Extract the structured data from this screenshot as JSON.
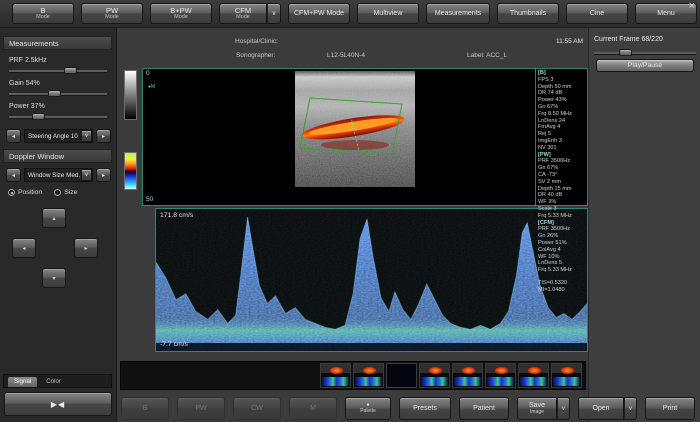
{
  "icons": {
    "close": "×",
    "dropdown": "∨",
    "arrow_left": "◂",
    "arrow_right": "▸",
    "arrow_up": "▴",
    "arrow_down": "▾",
    "collapse": "▶◀",
    "palette_dot": "●"
  },
  "toolbar": {
    "buttons": [
      {
        "label": "B",
        "sub": "Mode"
      },
      {
        "label": "PW",
        "sub": "Mode"
      },
      {
        "label": "B+PW",
        "sub": "Mode"
      },
      {
        "label": "CFM",
        "sub": "Mode"
      },
      {
        "label": "CFM+PW Mode"
      },
      {
        "label": "Multiview"
      },
      {
        "label": "Measurements"
      },
      {
        "label": "Thumbnails"
      },
      {
        "label": "Cine"
      },
      {
        "label": "Menu"
      }
    ]
  },
  "left_panel": {
    "measurements_header": "Measurements",
    "prf_label": "PRF 2.5kHz",
    "gain_label": "Gain 54%",
    "power_label": "Power 37%",
    "steering_label": "Steering Angle 10",
    "doppler_header": "Doppler Window",
    "window_size_label": "Window Size Med.",
    "radio_position": "Position",
    "radio_size": "Size",
    "tab_signal": "Signal",
    "tab_color": "Color"
  },
  "patient_bar": {
    "hospital": "Hospital/Clinic:",
    "time": "11:55 AM",
    "sonographer": "Sonographer:",
    "probe": "L12-5L40N-4",
    "label": "Label:  ACC_L"
  },
  "display": {
    "depth_top": "0",
    "depth_bottom": "50",
    "orientation_marker": "●M",
    "velocity_max": "171.8 cm/s",
    "velocity_min": "-7.7 cm/s"
  },
  "params": {
    "b_header": "[B]",
    "b_lines": [
      "FPS 3",
      "Depth 50 mm",
      "DR 74 dB",
      "Power 43%",
      "Gn 67%",
      "Frq 8.50 MHz",
      "LnDens 24",
      "FmAvg 4",
      "Rej 5",
      "ImgEnh 3",
      "NV 301"
    ],
    "pw_header": "[PW]",
    "pw_lines": [
      "PRF 3500Hz",
      "Gn 67%",
      "CA -73°",
      "SV 2 mm",
      "Depth 15 mm",
      "DR 40 dB",
      "WF 3%",
      "Scale 3",
      "Frq 5.33 MHz"
    ],
    "cfm_header": "[CFM]",
    "cfm_lines": [
      "PRF 3500Hz",
      "Gn 26%",
      "Power 51%",
      "ColAvg 4",
      "WF 10%",
      "LnDens 5",
      "Frq 5.33 MHz"
    ],
    "safety_lines": [
      "TIS=0.5320",
      "MI=1.0480"
    ]
  },
  "right_panel": {
    "current_frame": "Current Frame 68/220",
    "play_pause": "Play/Pause"
  },
  "bottom_bar": {
    "disabled_buttons": [
      "B",
      "PW",
      "CW",
      "M"
    ],
    "palette": "Palette",
    "presets": "Presets",
    "patient": "Patient",
    "save": "Save",
    "save_sub": "Image",
    "open": "Open",
    "print": "Print"
  }
}
